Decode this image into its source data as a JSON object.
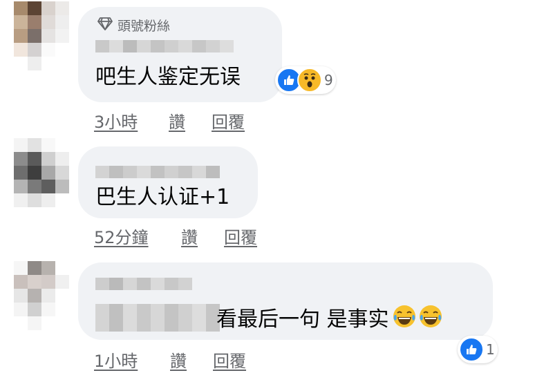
{
  "comments": [
    {
      "badge": "頭號粉絲",
      "text": "吧生人鉴定无误",
      "reaction_count": "9",
      "time": "3小時",
      "like_label": "讚",
      "reply_label": "回覆"
    },
    {
      "text": "巴生人认证+1",
      "time": "52分鐘",
      "like_label": "讚",
      "reply_label": "回覆"
    },
    {
      "text": "看最后一句 是事实",
      "reaction_count": "1",
      "time": "1小時",
      "like_label": "讚",
      "reply_label": "回覆"
    }
  ],
  "icons": {
    "badge": "diamond-icon",
    "like": "like-reaction-icon",
    "wow": "wow-reaction-icon",
    "laugh": "laughing-crying-emoji-icon"
  },
  "colors": {
    "like_blue": "#1877f2",
    "wow_yellow": "#f7b928",
    "bubble_bg": "#f0f2f5",
    "meta_text": "#65676b"
  }
}
